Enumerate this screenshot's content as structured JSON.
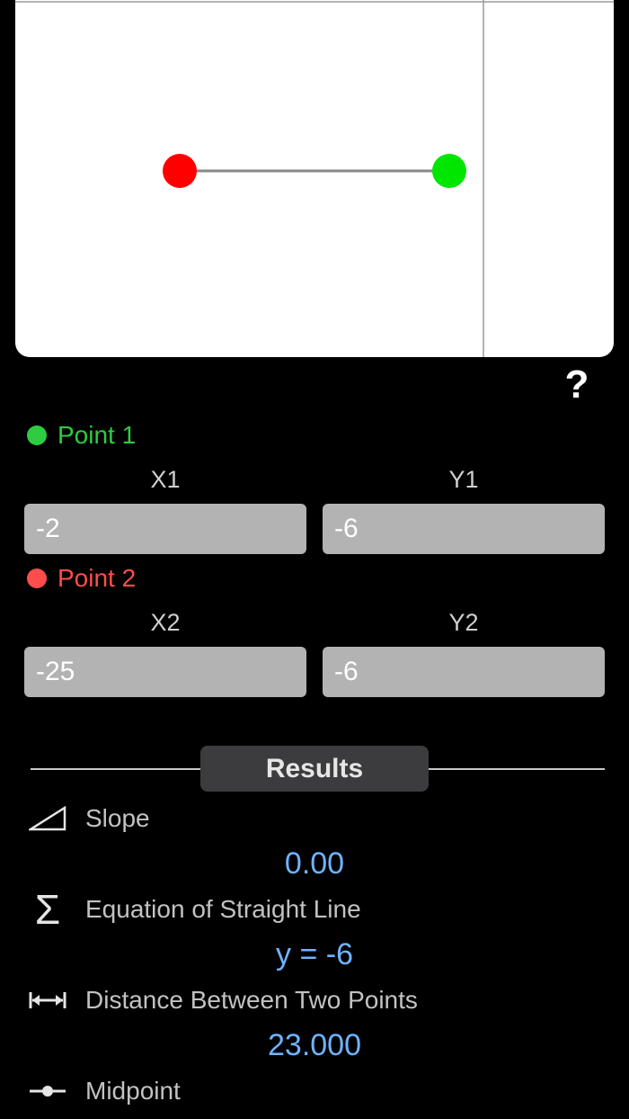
{
  "graph": {
    "point1_color": "#00e600",
    "point2_color": "#ff0000",
    "line_color": "#888888"
  },
  "help_label": "?",
  "point1": {
    "title": "Point 1",
    "color": "#2ecc40",
    "x_label": "X1",
    "y_label": "Y1",
    "x_value": "-2",
    "y_value": "-6"
  },
  "point2": {
    "title": "Point 2",
    "color": "#ff4d4d",
    "x_label": "X2",
    "y_label": "Y2",
    "x_value": "-25",
    "y_value": "-6"
  },
  "results": {
    "title": "Results",
    "slope_label": "Slope",
    "slope_value": "0.00",
    "equation_label": "Equation of Straight Line",
    "equation_value": "y = -6",
    "distance_label": "Distance Between Two Points",
    "distance_value": "23.000",
    "midpoint_label": "Midpoint"
  }
}
